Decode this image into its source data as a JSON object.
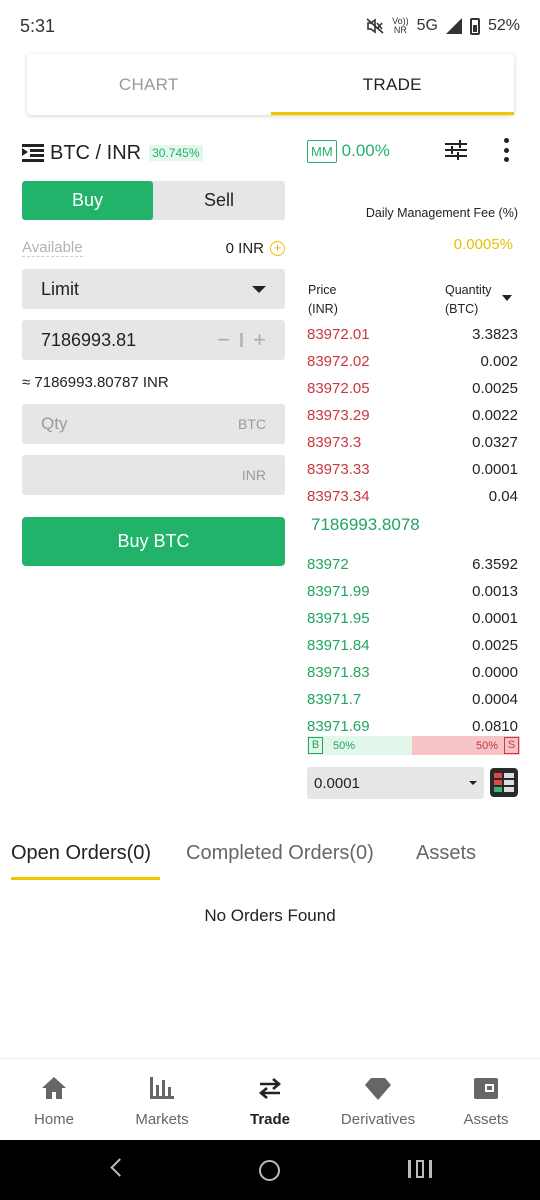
{
  "status_bar": {
    "time": "5:31",
    "net_top": "Vo))",
    "net_bottom": "NR",
    "network": "5G",
    "battery": "52%"
  },
  "top_tabs": [
    {
      "label": "CHART"
    },
    {
      "label": "TRADE"
    }
  ],
  "pair": {
    "name": "BTC / INR",
    "change": "30.745%"
  },
  "mm": {
    "badge": "MM",
    "value": "0.00%"
  },
  "order_side": {
    "buy": "Buy",
    "sell": "Sell"
  },
  "available": {
    "label": "Available",
    "value": "0 INR",
    "add": "+"
  },
  "order_type": "Limit",
  "price_input": {
    "value": "7186993.81",
    "minus": "−",
    "plus": "+"
  },
  "approx_value": "≈ 7186993.80787 INR",
  "qty_input": {
    "placeholder": "Qty",
    "unit": "BTC"
  },
  "total_input": {
    "unit": "INR"
  },
  "submit_label": "Buy BTC",
  "fee": {
    "label": "Daily Management Fee (%)",
    "value": "0.0005%"
  },
  "orderbook": {
    "price_header": "Price",
    "price_unit": "(INR)",
    "qty_header": "Quantity",
    "qty_unit": "(BTC)",
    "asks": [
      {
        "price": "83972.01",
        "qty": "3.3823"
      },
      {
        "price": "83972.02",
        "qty": "0.002"
      },
      {
        "price": "83972.05",
        "qty": "0.0025"
      },
      {
        "price": "83973.29",
        "qty": "0.0022"
      },
      {
        "price": "83973.3",
        "qty": "0.0327"
      },
      {
        "price": "83973.33",
        "qty": "0.0001"
      },
      {
        "price": "83973.34",
        "qty": "0.04"
      }
    ],
    "mid_price": "7186993.8078",
    "bids": [
      {
        "price": "83972",
        "qty": "6.3592"
      },
      {
        "price": "83971.99",
        "qty": "0.0013"
      },
      {
        "price": "83971.95",
        "qty": "0.0001"
      },
      {
        "price": "83971.84",
        "qty": "0.0025"
      },
      {
        "price": "83971.83",
        "qty": "0.0000"
      },
      {
        "price": "83971.7",
        "qty": "0.0004"
      },
      {
        "price": "83971.69",
        "qty": "0.0810"
      }
    ],
    "buy_ratio": {
      "tag": "B",
      "value": "50%"
    },
    "sell_ratio": {
      "tag": "S",
      "value": "50%"
    },
    "depth": "0.0001"
  },
  "order_tabs": [
    {
      "label": "Open Orders(0)"
    },
    {
      "label": "Completed Orders(0)"
    },
    {
      "label": "Assets"
    }
  ],
  "empty_message": "No Orders Found",
  "bottom_nav": [
    {
      "label": "Home",
      "icon": "home-icon"
    },
    {
      "label": "Markets",
      "icon": "bar-chart-icon"
    },
    {
      "label": "Trade",
      "icon": "swap-arrows-icon"
    },
    {
      "label": "Derivatives",
      "icon": "diamond-icon"
    },
    {
      "label": "Assets",
      "icon": "wallet-icon"
    }
  ],
  "colors": {
    "green": "#22b36a",
    "red": "#c8383f",
    "yellow": "#f0c800"
  }
}
